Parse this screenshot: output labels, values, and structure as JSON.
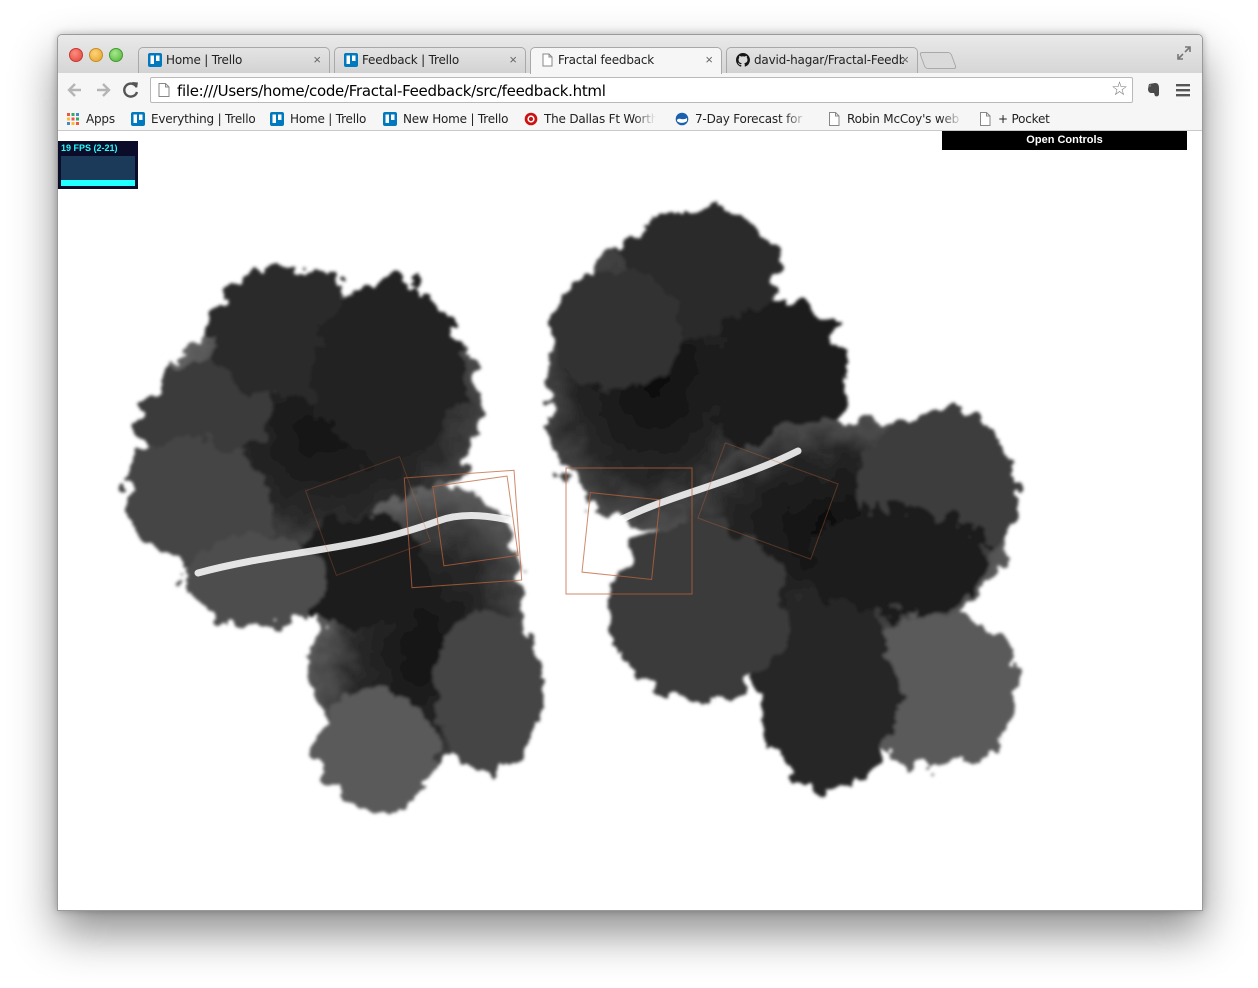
{
  "browser": {
    "tabs": [
      {
        "title": "Home | Trello",
        "icon": "trello-icon",
        "active": false
      },
      {
        "title": "Feedback | Trello",
        "icon": "trello-icon",
        "active": false
      },
      {
        "title": "Fractal feedback",
        "icon": "page-icon",
        "active": true
      },
      {
        "title": "david-hagar/Fractal-Feedb",
        "icon": "github-icon",
        "active": false
      }
    ],
    "close_glyph": "×",
    "url": "file:///Users/home/code/Fractal-Feedback/src/feedback.html"
  },
  "bookmarks": [
    {
      "label": "Apps",
      "icon": "apps-grid-icon"
    },
    {
      "label": "Everything | Trello",
      "icon": "trello-icon"
    },
    {
      "label": "Home | Trello",
      "icon": "trello-icon"
    },
    {
      "label": "New Home | Trello",
      "icon": "trello-icon"
    },
    {
      "label": "The Dallas Ft Worth,",
      "icon": "weather-sun-icon"
    },
    {
      "label": "7-Day Forecast for L",
      "icon": "noaa-icon"
    },
    {
      "label": "Robin McCoy's web s",
      "icon": "page-icon"
    },
    {
      "label": "+ Pocket",
      "icon": "page-icon"
    }
  ],
  "page": {
    "fps_label": "19 FPS (2-21)",
    "fps_level": 0.2,
    "controls_label": "Open Controls"
  },
  "colors": {
    "trello_blue": "#0079bf",
    "fps_cyan": "#22ffff",
    "fps_bg": "#0b0b2a",
    "overlay_squares": "#c0643c"
  }
}
